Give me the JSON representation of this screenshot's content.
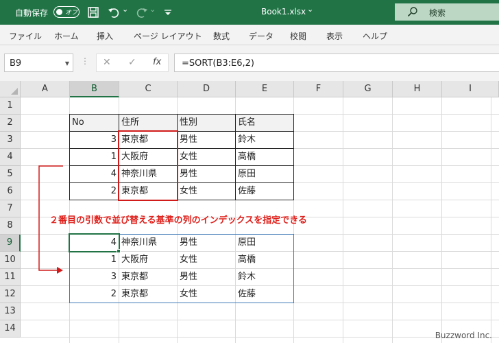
{
  "titlebar": {
    "autosave_label": "自動保存",
    "autosave_state": "オフ",
    "filename": "Book1.xlsx",
    "filename_caret": "⌄",
    "qat_more": "⌄",
    "search_label": "検索"
  },
  "ribbon": {
    "tabs": [
      "ファイル",
      "ホーム",
      "挿入",
      "ページ レイアウト",
      "数式",
      "データ",
      "校閲",
      "表示",
      "ヘルプ"
    ]
  },
  "formula_bar": {
    "name_box": "B9",
    "cancel": "✕",
    "enter": "✓",
    "fx": "fx",
    "formula": "=SORT(B3:E6,2)"
  },
  "grid": {
    "columns": [
      "A",
      "B",
      "C",
      "D",
      "E",
      "F",
      "G",
      "H",
      "I"
    ],
    "rows": [
      "1",
      "2",
      "3",
      "4",
      "5",
      "6",
      "7",
      "8",
      "9",
      "10",
      "11",
      "12",
      "13",
      "14"
    ],
    "selected_column": "B",
    "selected_row": "9"
  },
  "source_table": {
    "headers": [
      "No",
      "住所",
      "性別",
      "氏名"
    ],
    "rows": [
      [
        "3",
        "東京都",
        "男性",
        "鈴木"
      ],
      [
        "1",
        "大阪府",
        "女性",
        "高橋"
      ],
      [
        "4",
        "神奈川県",
        "男性",
        "原田"
      ],
      [
        "2",
        "東京都",
        "女性",
        "佐藤"
      ]
    ]
  },
  "result_table": {
    "rows": [
      [
        "4",
        "神奈川県",
        "男性",
        "原田"
      ],
      [
        "1",
        "大阪府",
        "女性",
        "高橋"
      ],
      [
        "3",
        "東京都",
        "男性",
        "鈴木"
      ],
      [
        "2",
        "東京都",
        "女性",
        "佐藤"
      ]
    ]
  },
  "annotation": "２番目の引数で並び替える基準の列のインデックスを指定できる",
  "credit": "Buzzword Inc.",
  "colors": {
    "excel_green": "#217346",
    "annotation_red": "#e0201b",
    "spill_blue": "#3c78b5"
  }
}
